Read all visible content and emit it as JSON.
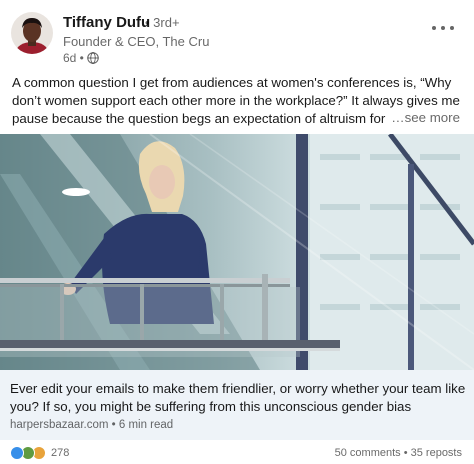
{
  "author": {
    "name": "Tiffany Dufu",
    "degree": "• 3rd+",
    "headline": "Founder & CEO, The Cru",
    "time": "6d •"
  },
  "commentary": {
    "text": "A common question I get from audiences at women's conferences is, “Why don’t women support each other more in the workplace?” It always gives me pause because the question begs an expectation of altruism for women that we",
    "see_more": "…see more"
  },
  "article": {
    "title": "Ever edit your emails to make them friendlier, or worry whether your team like you? If so, you might be suffering from this unconscious gender bias",
    "source": "harpersbazaar.com • 6 min read"
  },
  "social": {
    "reaction_count": "278",
    "comments": "50 comments",
    "separator": " • ",
    "reposts": "35 reposts"
  },
  "icons": {
    "more": "more-options-icon",
    "visibility": "globe-icon",
    "reactions": [
      "like-icon",
      "celebrate-icon",
      "support-icon"
    ]
  },
  "colors": {
    "card_background": "#eef3f8",
    "like": "#378fe9",
    "celebrate": "#5f9b41",
    "support": "#e8a33b"
  }
}
